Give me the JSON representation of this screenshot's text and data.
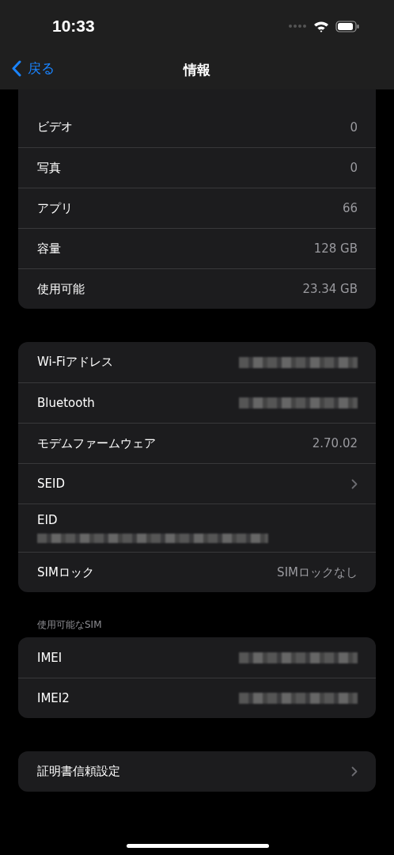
{
  "status_bar": {
    "time": "10:33"
  },
  "nav": {
    "back": "戻る",
    "title": "情報"
  },
  "groups": [
    {
      "rows": [
        {
          "kind": "value",
          "label": "ビデオ",
          "value": "0"
        },
        {
          "kind": "value",
          "label": "写真",
          "value": "0"
        },
        {
          "kind": "value",
          "label": "アプリ",
          "value": "66"
        },
        {
          "kind": "value",
          "label": "容量",
          "value": "128 GB"
        },
        {
          "kind": "value",
          "label": "使用可能",
          "value": "23.34 GB"
        }
      ],
      "cut_top": true
    },
    {
      "rows": [
        {
          "kind": "redacted",
          "label": "Wi-Fiアドレス"
        },
        {
          "kind": "redacted",
          "label": "Bluetooth"
        },
        {
          "kind": "value",
          "label": "モデムファームウェア",
          "value": "2.70.02"
        },
        {
          "kind": "disclosure",
          "label": "SEID"
        },
        {
          "kind": "stacked",
          "label": "EID"
        },
        {
          "kind": "value",
          "label": "SIMロック",
          "value": "SIMロックなし"
        }
      ]
    },
    {
      "header": "使用可能なSIM",
      "rows": [
        {
          "kind": "redacted",
          "label": "IMEI"
        },
        {
          "kind": "redacted",
          "label": "IMEI2"
        }
      ]
    },
    {
      "rows": [
        {
          "kind": "disclosure",
          "label": "証明書信頼設定"
        }
      ]
    }
  ]
}
